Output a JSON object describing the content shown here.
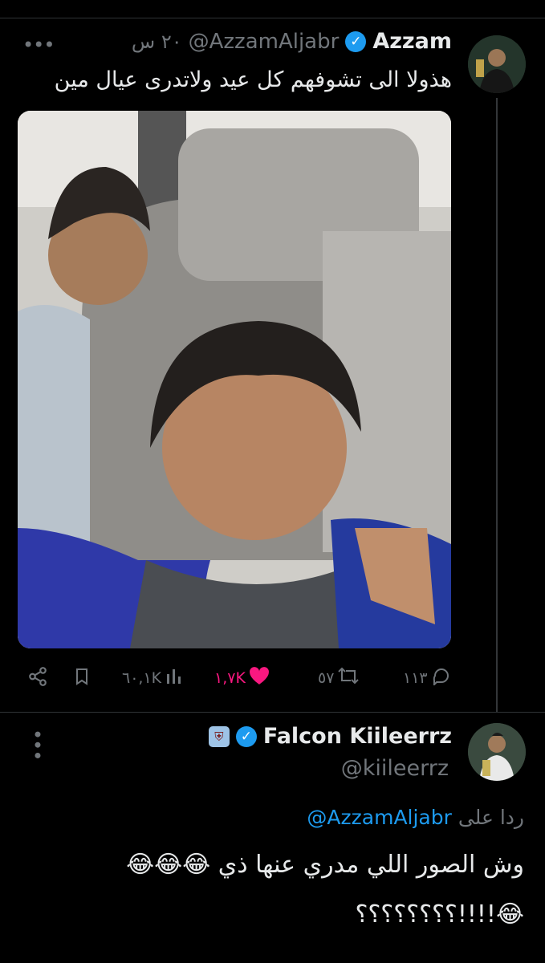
{
  "tweet": {
    "author_name": "Azzam",
    "handle": "@AzzamAljabr",
    "time": "٢٠ س",
    "text": "هذولا الى تشوفهم كل عيد ولاتدرى عيال مين",
    "stats": {
      "replies": "١١٣",
      "retweets": "٥٧",
      "likes": "١,٧K",
      "views": "٦٠,١K"
    }
  },
  "reply": {
    "author_name": "Falcon Kiileerrz",
    "handle": "@kiileerrz",
    "replying_prefix": "ردا على",
    "replying_to": "@AzzamAljabr",
    "line1": "وش الصور اللي مدري عنها ذي 😂😂😂",
    "line2": "😂!!!!؟؟؟؟؟؟؟؟"
  },
  "icons": {
    "verified": "verified-badge-icon",
    "more": "more-dots-icon",
    "reply": "reply-bubble-icon",
    "retweet": "retweet-icon",
    "like": "heart-icon",
    "views": "views-bars-icon",
    "bookmark": "bookmark-icon",
    "share": "share-icon"
  },
  "colors": {
    "like_active": "#f91880",
    "verified": "#1d9bf0",
    "mention": "#1d9bf0"
  }
}
